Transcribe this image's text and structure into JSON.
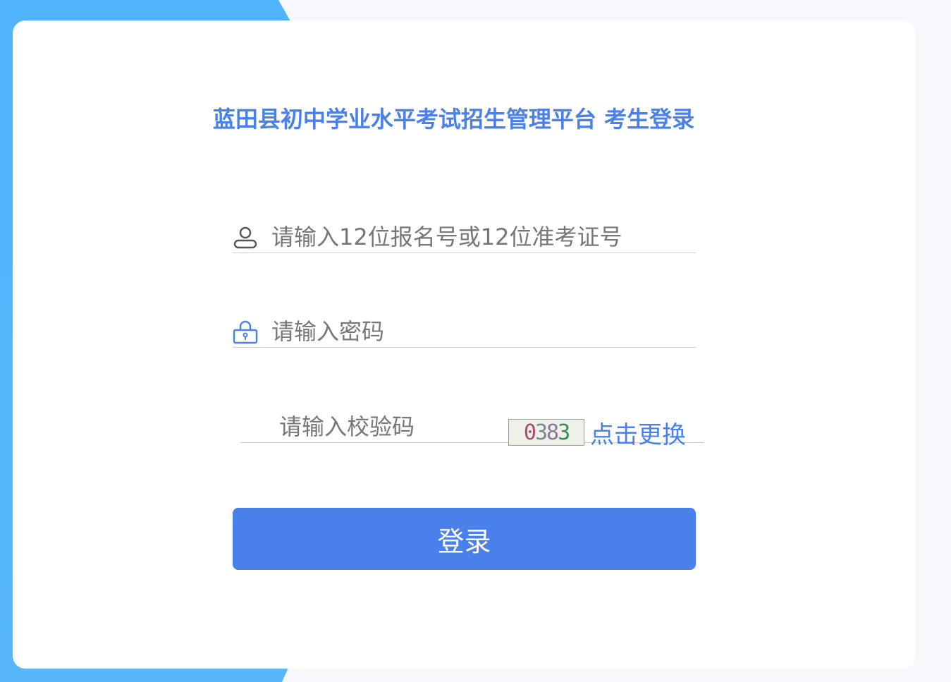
{
  "page": {
    "title": "蓝田县初中学业水平考试招生管理平台 考生登录"
  },
  "form": {
    "username": {
      "placeholder": "请输入12位报名号或12位准考证号",
      "value": "",
      "icon": "user-icon"
    },
    "password": {
      "placeholder": "请输入密码",
      "value": "",
      "icon": "lock-icon"
    },
    "captcha": {
      "placeholder": "请输入校验码",
      "value": "",
      "image_text": [
        "0",
        "3",
        "8",
        "3"
      ],
      "refresh_label": "点击更换"
    },
    "submit_label": "登录"
  },
  "colors": {
    "accent": "#4a80ea",
    "side_blue": "#4fb4fb",
    "background": "#f6f8fc"
  }
}
